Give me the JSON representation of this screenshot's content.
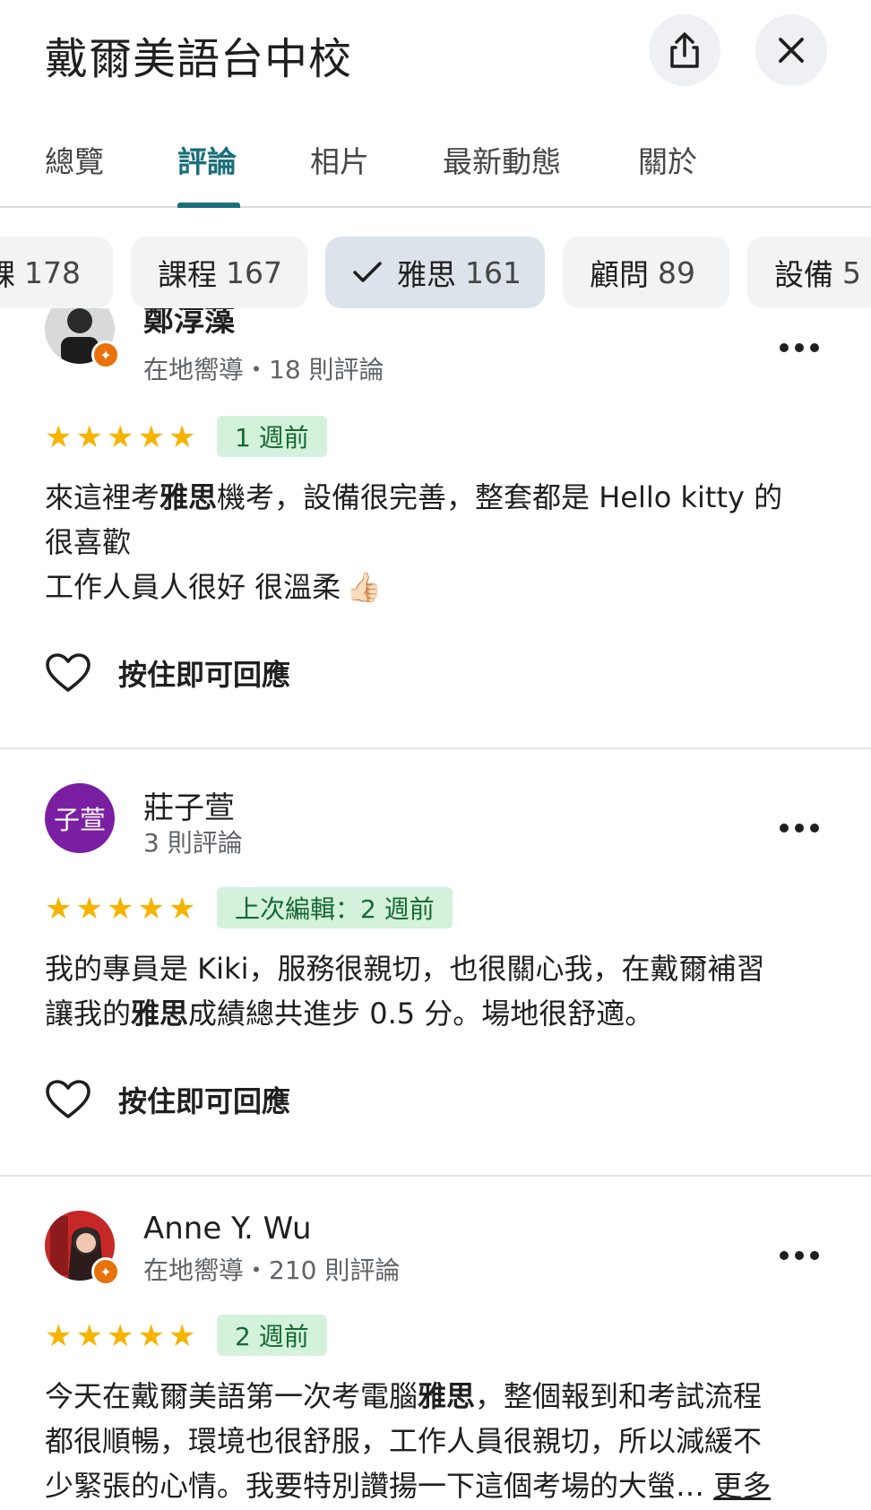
{
  "header": {
    "title": "戴爾美語台中校",
    "share_icon": "share-icon",
    "close_icon": "close-icon"
  },
  "tabs": [
    {
      "label": "總覽",
      "active": false
    },
    {
      "label": "評論",
      "active": true
    },
    {
      "label": "相片",
      "active": false
    },
    {
      "label": "最新動態",
      "active": false
    },
    {
      "label": "關於",
      "active": false
    }
  ],
  "chips": [
    {
      "label": "課",
      "count": "178",
      "selected": false
    },
    {
      "label": "課程",
      "count": "167",
      "selected": false
    },
    {
      "label": "雅思",
      "count": "161",
      "selected": true
    },
    {
      "label": "顧問",
      "count": "89",
      "selected": false
    },
    {
      "label": "設備",
      "count": "5",
      "selected": false
    }
  ],
  "reviews": [
    {
      "name": "鄭淳藻",
      "meta": "在地嚮導・18 則評論",
      "rating": 5,
      "time": "1 週前",
      "text_lines": [
        "來這裡考雅思機考，設備很完善，整套都是 Hello kitty 的",
        "很喜歡",
        "工作人員人很好 很溫柔"
      ],
      "highlight": "雅思",
      "like_label": "按住即可回應"
    },
    {
      "name": "莊子萱",
      "avatar_text": "子萱",
      "avatar_color": "#7b1fa2",
      "meta": "3 則評論",
      "rating": 5,
      "time": "上次編輯：2 週前",
      "text_lines": [
        "我的專員是 Kiki，服務很親切，也很關心我，在戴爾補習",
        "讓我的雅思成績總共進步 0.5 分。場地很舒適。"
      ],
      "highlight": "雅思",
      "like_label": "按住即可回應"
    },
    {
      "name": "Anne Y. Wu",
      "meta": "在地嚮導・210 則評論",
      "rating": 5,
      "time": "2 週前",
      "text_lines": [
        "今天在戴爾美語第一次考電腦雅思，整個報到和考試流程",
        "都很順暢，環境也很舒服，工作人員很親切，所以減緩不",
        "少緊張的心情。我要特別讚揚一下這個考場的大螢…"
      ],
      "highlight": "雅思",
      "more_label": "更多"
    }
  ],
  "colors": {
    "accent": "#1a6f7b",
    "star": "#f4b400",
    "pill_bg": "#d4f1dc",
    "pill_text": "#156a33",
    "guide_badge": "#e8710a"
  }
}
